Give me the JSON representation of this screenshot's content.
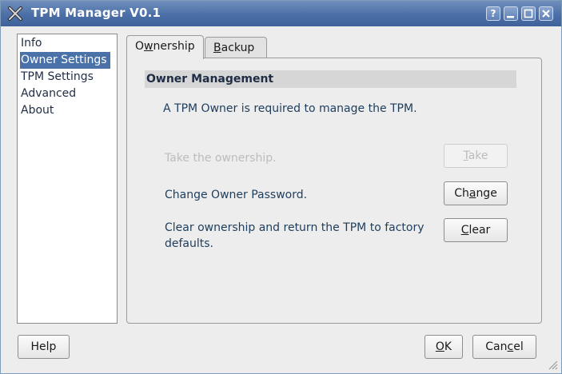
{
  "window": {
    "title": "TPM Manager V0.1"
  },
  "titlebar_buttons": {
    "help": "?",
    "minimize": "_",
    "maximize": "□",
    "close": "X"
  },
  "sidebar": {
    "items": [
      {
        "label": "Info",
        "selected": false
      },
      {
        "label": "Owner Settings",
        "selected": true
      },
      {
        "label": "TPM Settings",
        "selected": false
      },
      {
        "label": "Advanced",
        "selected": false
      },
      {
        "label": "About",
        "selected": false
      }
    ]
  },
  "tabs": [
    {
      "label_pre": "O",
      "label_u": "w",
      "label_post": "nership",
      "active": true
    },
    {
      "label_pre": "",
      "label_u": "B",
      "label_post": "ackup",
      "active": false
    }
  ],
  "group": {
    "title": "Owner Management"
  },
  "intro": "A TPM Owner is required to manage the TPM.",
  "actions": {
    "take": {
      "text": "Take the ownership.",
      "btn_u": "T",
      "btn_post": "ake",
      "enabled": false
    },
    "change": {
      "text": "Change Owner Password.",
      "btn_pre": "Ch",
      "btn_u": "a",
      "btn_post": "nge",
      "enabled": true
    },
    "clear": {
      "text_line1": "Clear ownership and return the TPM to factory",
      "text_line2": "defaults.",
      "btn_u": "C",
      "btn_post": "lear",
      "enabled": true
    }
  },
  "footer": {
    "help": "Help",
    "ok_u": "O",
    "ok_post": "K",
    "cancel_pre": "Can",
    "cancel_u": "c",
    "cancel_post": "el"
  },
  "colors": {
    "titlebar": "#4b6fa6",
    "selection": "#4a72a9",
    "text": "#1e3d5c"
  }
}
